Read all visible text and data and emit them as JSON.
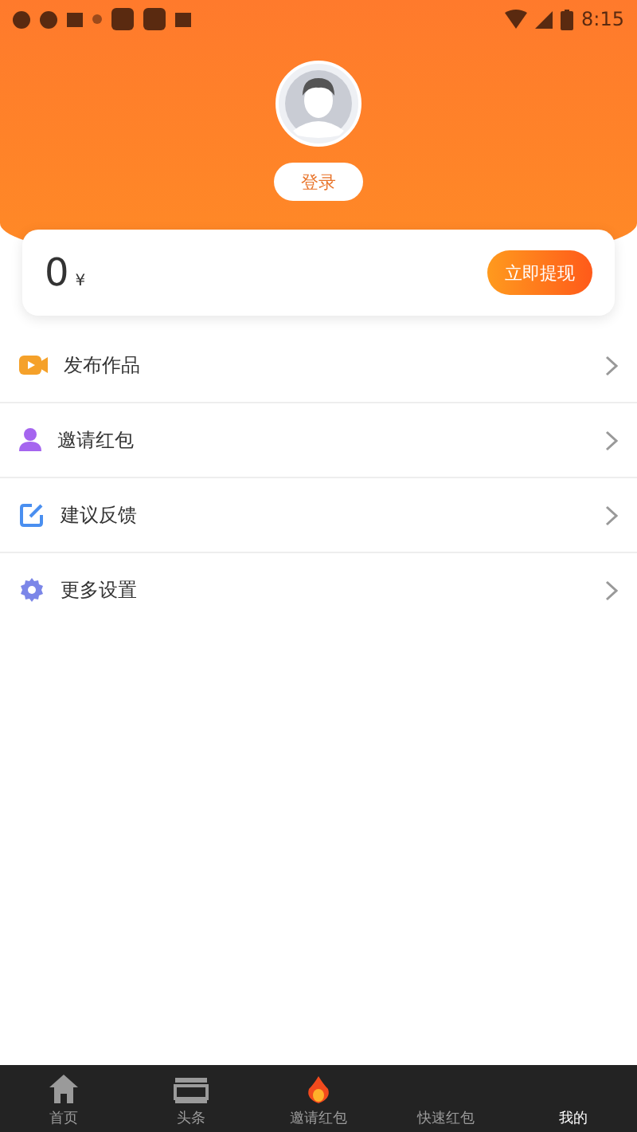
{
  "status_bar": {
    "time": "8:15"
  },
  "profile": {
    "login_button": "登录"
  },
  "balance": {
    "amount": "0",
    "currency": "¥",
    "withdraw_button": "立即提现"
  },
  "menu": [
    {
      "kind": "video",
      "label": "发布作品"
    },
    {
      "kind": "person",
      "label": "邀请红包"
    },
    {
      "kind": "edit",
      "label": "建议反馈"
    },
    {
      "kind": "gear",
      "label": "更多设置"
    }
  ],
  "bottom_nav": [
    {
      "kind": "home",
      "label": "首页",
      "selected": false
    },
    {
      "kind": "news",
      "label": "头条",
      "selected": false
    },
    {
      "kind": "fire",
      "label": "邀请红包",
      "selected": false
    },
    {
      "kind": "none",
      "label": "快速红包",
      "selected": false
    },
    {
      "kind": "none",
      "label": "我的",
      "selected": true
    }
  ]
}
